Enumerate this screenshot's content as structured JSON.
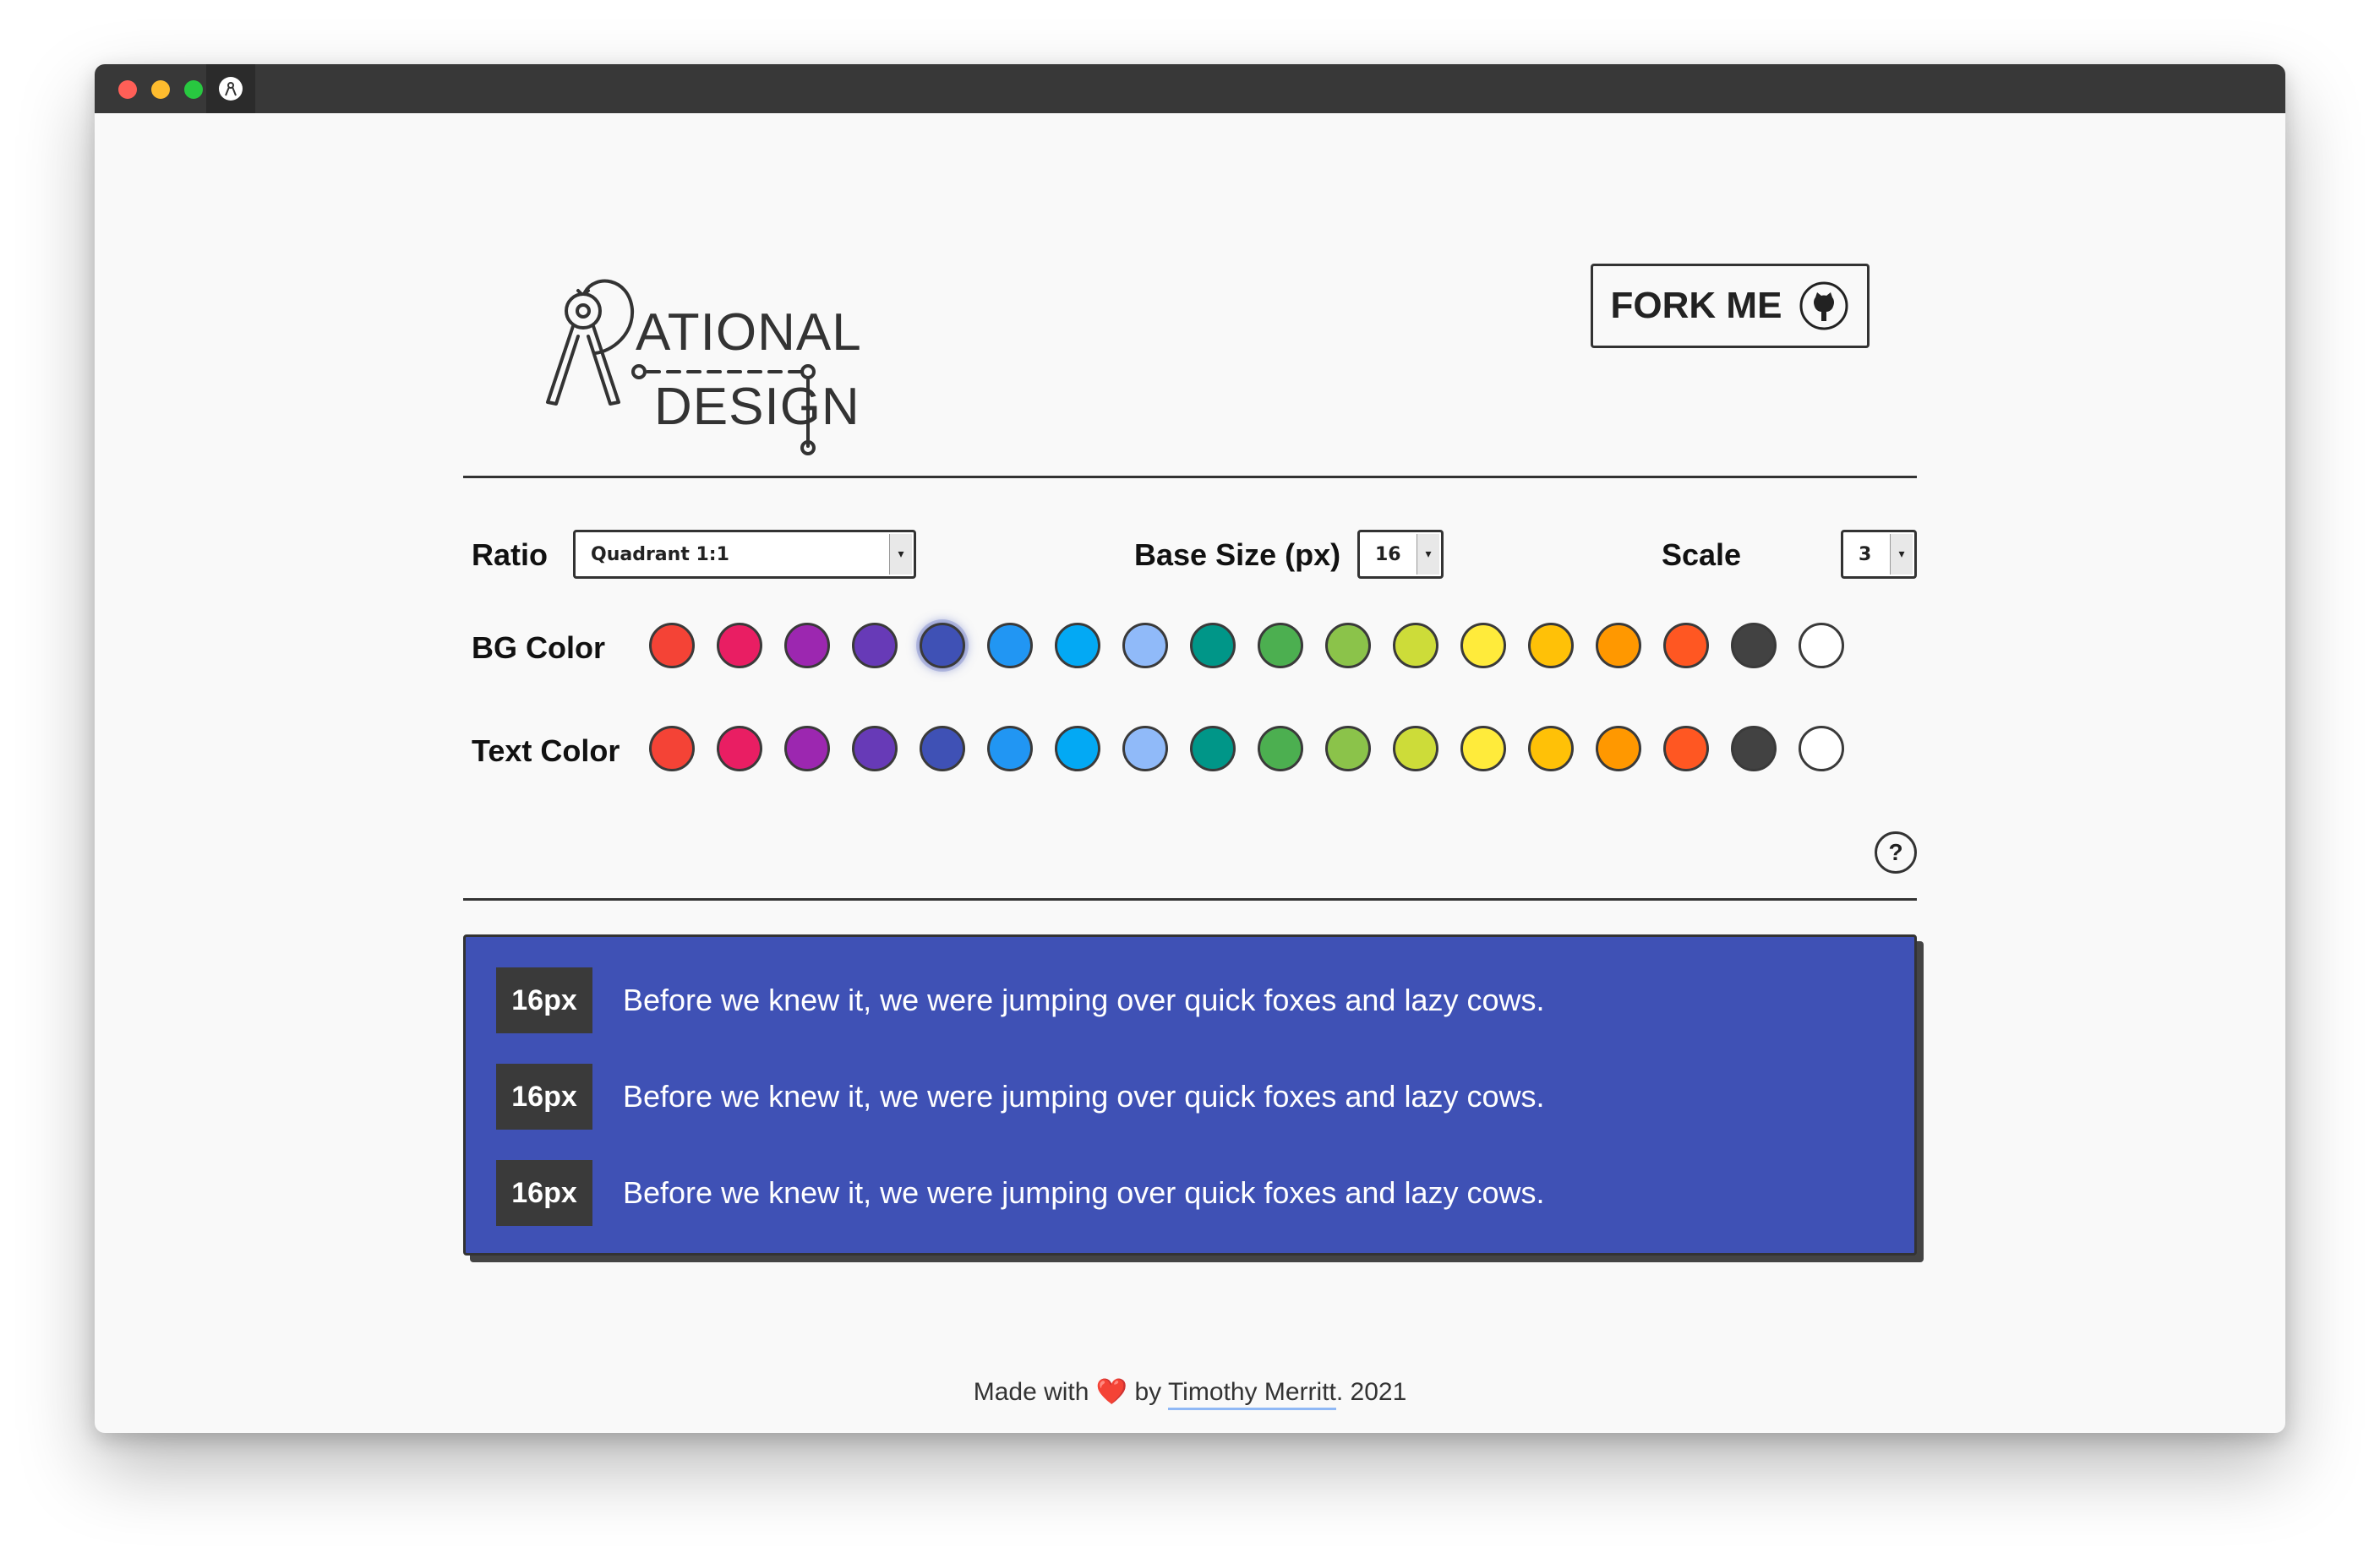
{
  "logo": {
    "top_word": "ATIONAL",
    "bottom_word": "DESIGN",
    "dashes": "-------"
  },
  "header": {
    "fork_label": "FORK ME"
  },
  "controls": {
    "ratio_label": "Ratio",
    "ratio_value": "Quadrant 1:1",
    "base_size_label": "Base Size (px)",
    "base_size_value": "16",
    "scale_label": "Scale",
    "scale_value": "3",
    "bg_color_label": "BG Color",
    "text_color_label": "Text Color",
    "help_label": "?"
  },
  "palette": [
    "#f44336",
    "#e91e63",
    "#9c27b0",
    "#673ab7",
    "#3f51b5",
    "#2196f3",
    "#03a9f4",
    "#90baf9",
    "#009688",
    "#4caf50",
    "#8bc34a",
    "#cddc39",
    "#ffeb3b",
    "#ffc107",
    "#ff9800",
    "#ff5722",
    "#424242",
    "#ffffff"
  ],
  "selected_bg_index": 4,
  "preview": {
    "background": "#3f51b5",
    "rows": [
      {
        "size": "16px",
        "text": "Before we knew it, we were jumping over quick foxes and lazy cows."
      },
      {
        "size": "16px",
        "text": "Before we knew it, we were jumping over quick foxes and lazy cows."
      },
      {
        "size": "16px",
        "text": "Before we knew it, we were jumping over quick foxes and lazy cows."
      }
    ]
  },
  "footer": {
    "made_with": "Made with",
    "heart": "❤️",
    "by": "by",
    "author": "Timothy Merritt",
    "year": ". 2021"
  }
}
